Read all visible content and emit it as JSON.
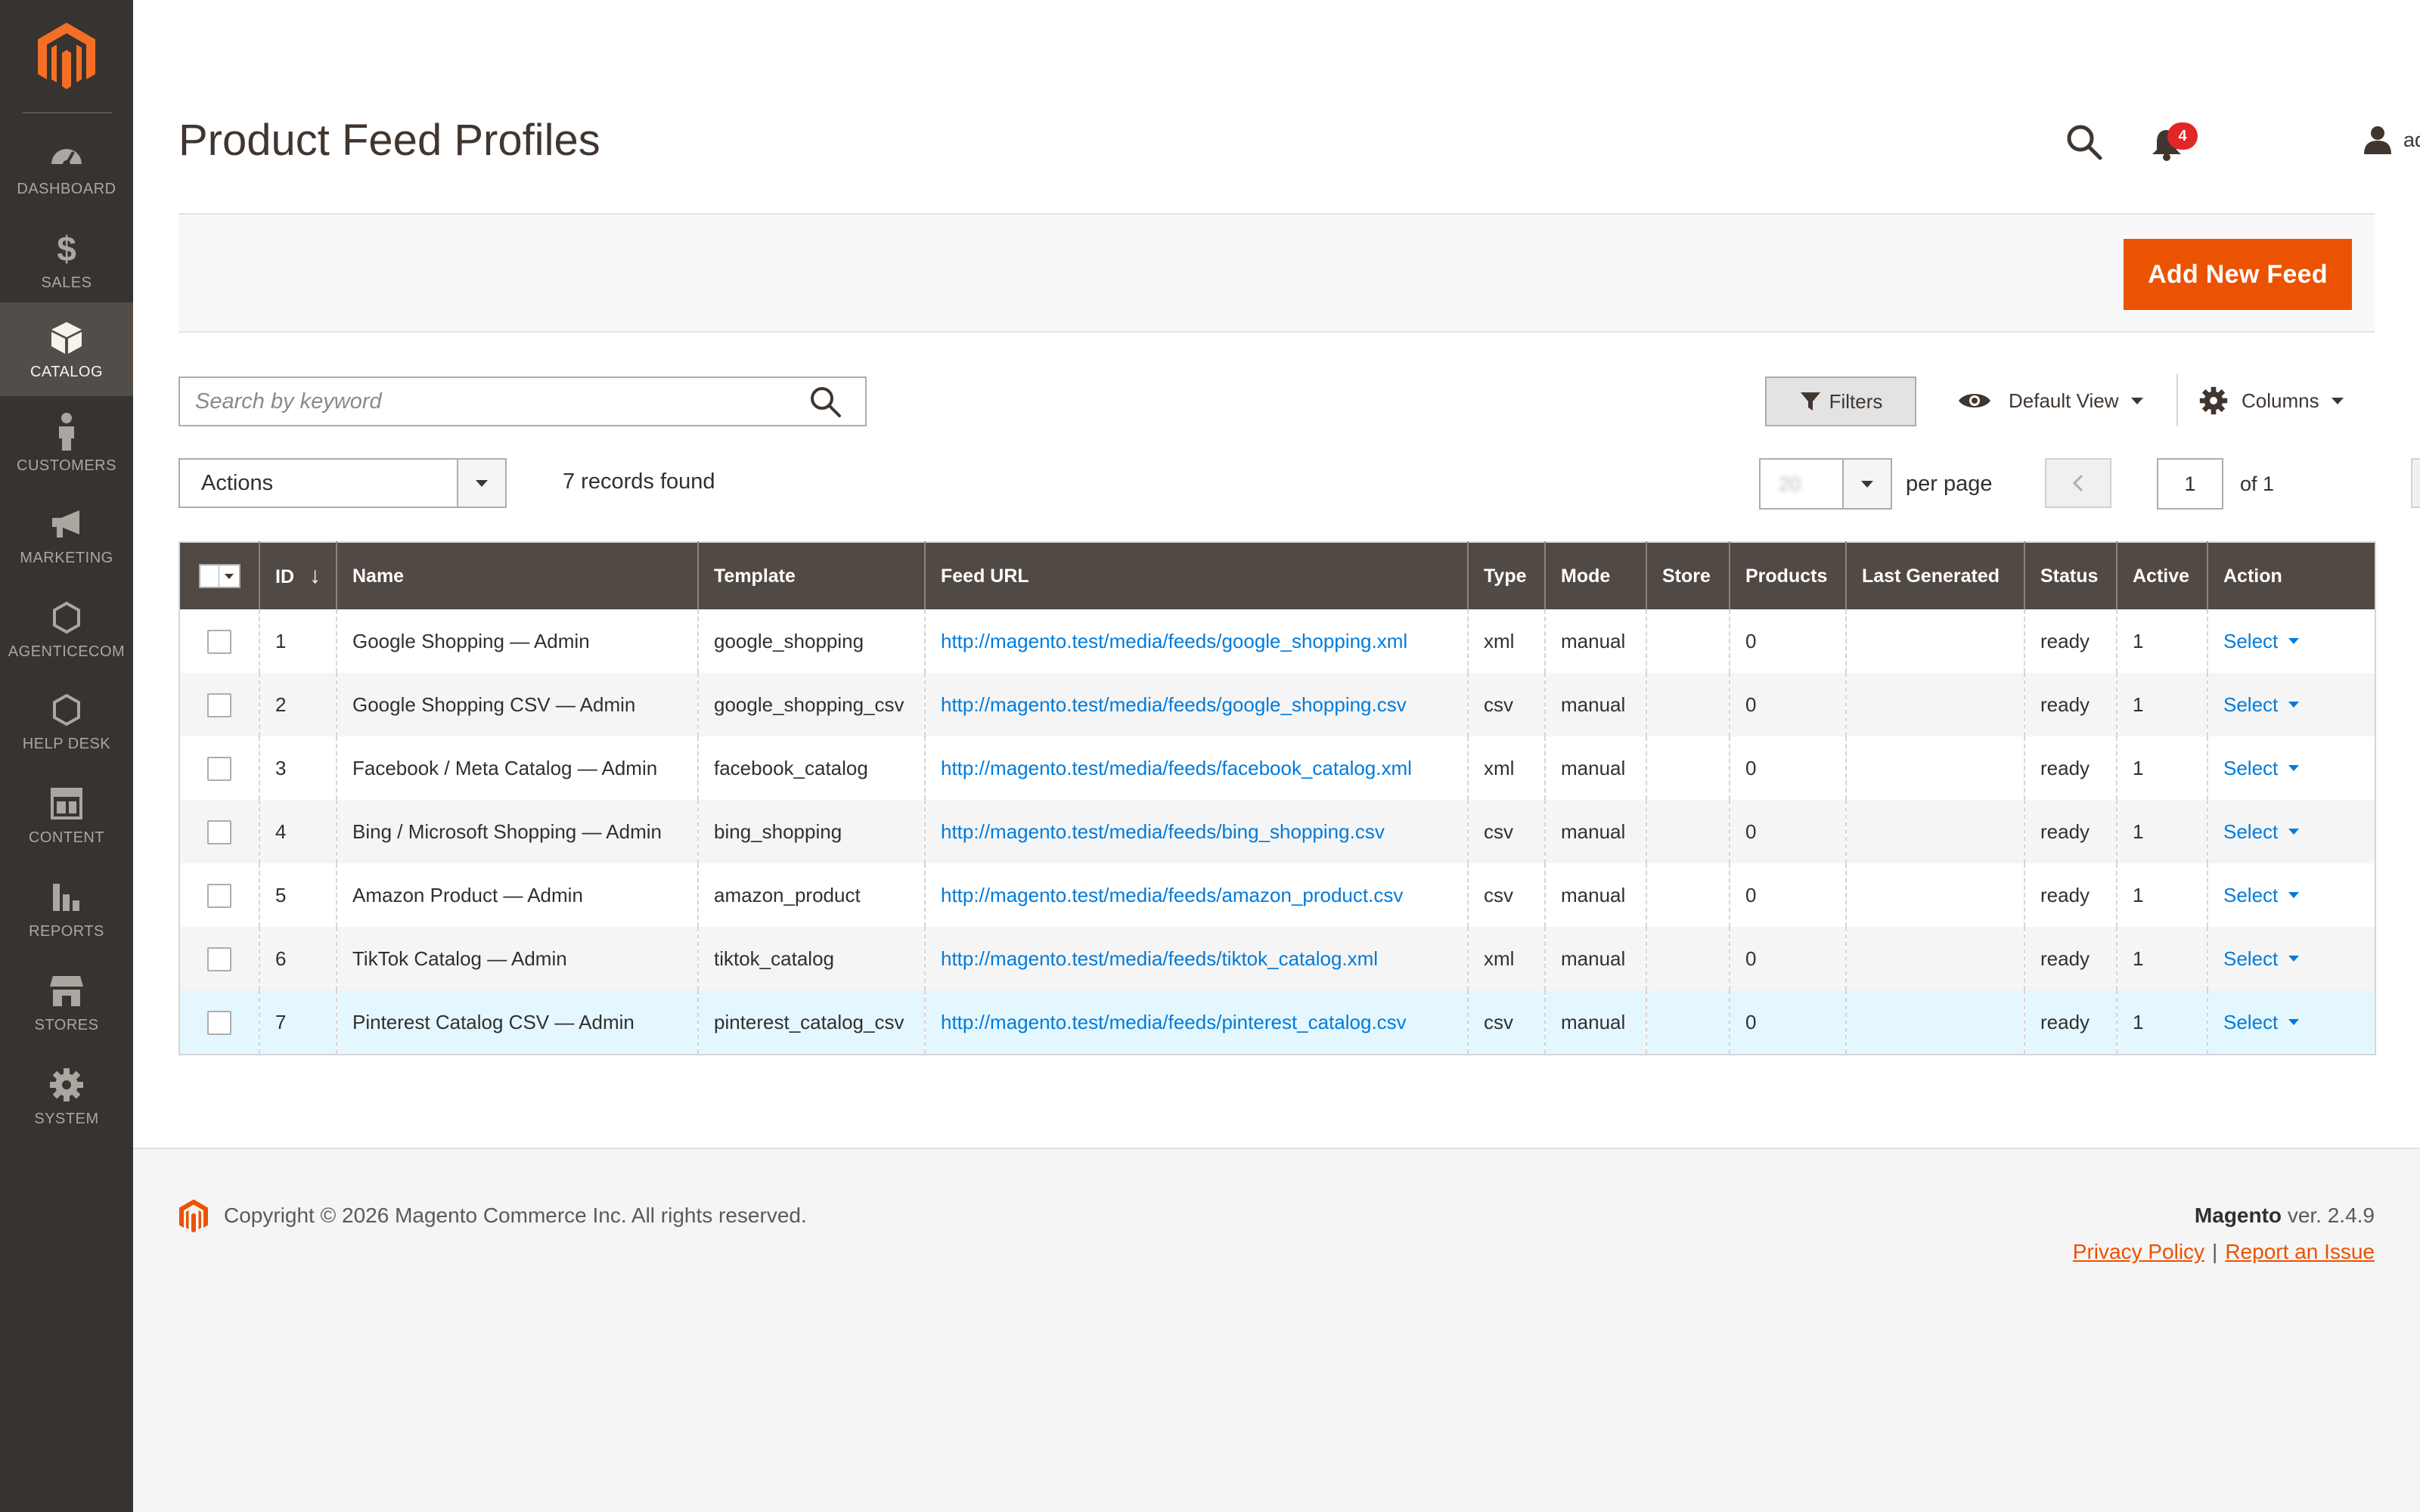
{
  "sidebar": {
    "items": [
      {
        "label": "DASHBOARD",
        "icon": "dashboard-icon"
      },
      {
        "label": "SALES",
        "icon": "dollar-icon"
      },
      {
        "label": "CATALOG",
        "icon": "cube-icon",
        "active": true
      },
      {
        "label": "CUSTOMERS",
        "icon": "person-icon"
      },
      {
        "label": "MARKETING",
        "icon": "megaphone-icon"
      },
      {
        "label": "AGENTICECOM",
        "icon": "hexagon-icon"
      },
      {
        "label": "HELP DESK",
        "icon": "hexagon-icon"
      },
      {
        "label": "CONTENT",
        "icon": "layout-icon"
      },
      {
        "label": "REPORTS",
        "icon": "bar-chart-icon"
      },
      {
        "label": "STORES",
        "icon": "storefront-icon"
      },
      {
        "label": "SYSTEM",
        "icon": "gear-icon"
      }
    ]
  },
  "header": {
    "title": "Product Feed Profiles",
    "notifications_count": "4",
    "user_name": "admin"
  },
  "toolbar": {
    "add_button": "Add New Feed",
    "search_placeholder": "Search by keyword",
    "filters_label": "Filters",
    "view_label": "Default View",
    "columns_label": "Columns",
    "actions_label": "Actions",
    "records_found": "7 records found",
    "per_page_value": "20",
    "per_page_label": "per page",
    "current_page": "1",
    "page_total": "of 1"
  },
  "grid": {
    "columns": [
      "ID",
      "Name",
      "Template",
      "Feed URL",
      "Type",
      "Mode",
      "Store",
      "Products",
      "Last Generated",
      "Status",
      "Active",
      "Action"
    ],
    "rows": [
      {
        "id": "1",
        "name": "Google Shopping — Admin",
        "template": "google_shopping",
        "url": "http://magento.test/media/feeds/google_shopping.xml",
        "type": "xml",
        "mode": "manual",
        "store": "",
        "products": "0",
        "last_generated": "",
        "status": "ready",
        "active": "1",
        "action": "Select"
      },
      {
        "id": "2",
        "name": "Google Shopping CSV — Admin",
        "template": "google_shopping_csv",
        "url": "http://magento.test/media/feeds/google_shopping.csv",
        "type": "csv",
        "mode": "manual",
        "store": "",
        "products": "0",
        "last_generated": "",
        "status": "ready",
        "active": "1",
        "action": "Select"
      },
      {
        "id": "3",
        "name": "Facebook / Meta Catalog — Admin",
        "template": "facebook_catalog",
        "url": "http://magento.test/media/feeds/facebook_catalog.xml",
        "type": "xml",
        "mode": "manual",
        "store": "",
        "products": "0",
        "last_generated": "",
        "status": "ready",
        "active": "1",
        "action": "Select"
      },
      {
        "id": "4",
        "name": "Bing / Microsoft Shopping — Admin",
        "template": "bing_shopping",
        "url": "http://magento.test/media/feeds/bing_shopping.csv",
        "type": "csv",
        "mode": "manual",
        "store": "",
        "products": "0",
        "last_generated": "",
        "status": "ready",
        "active": "1",
        "action": "Select"
      },
      {
        "id": "5",
        "name": "Amazon Product — Admin",
        "template": "amazon_product",
        "url": "http://magento.test/media/feeds/amazon_product.csv",
        "type": "csv",
        "mode": "manual",
        "store": "",
        "products": "0",
        "last_generated": "",
        "status": "ready",
        "active": "1",
        "action": "Select"
      },
      {
        "id": "6",
        "name": "TikTok Catalog — Admin",
        "template": "tiktok_catalog",
        "url": "http://magento.test/media/feeds/tiktok_catalog.xml",
        "type": "xml",
        "mode": "manual",
        "store": "",
        "products": "0",
        "last_generated": "",
        "status": "ready",
        "active": "1",
        "action": "Select"
      },
      {
        "id": "7",
        "name": "Pinterest Catalog CSV — Admin",
        "template": "pinterest_catalog_csv",
        "url": "http://magento.test/media/feeds/pinterest_catalog.csv",
        "type": "csv",
        "mode": "manual",
        "store": "",
        "products": "0",
        "last_generated": "",
        "status": "ready",
        "active": "1",
        "action": "Select"
      }
    ]
  },
  "footer": {
    "copyright": "Copyright © 2026 Magento Commerce Inc. All rights reserved.",
    "brand": "Magento",
    "version": "ver. 2.4.9",
    "privacy": "Privacy Policy",
    "separator": "|",
    "report": "Report an Issue"
  },
  "colors": {
    "brand_orange": "#eb5202",
    "sidebar_bg": "#373330",
    "grid_header_bg": "#514943",
    "link_blue": "#007bdb",
    "badge_red": "#e22626"
  }
}
